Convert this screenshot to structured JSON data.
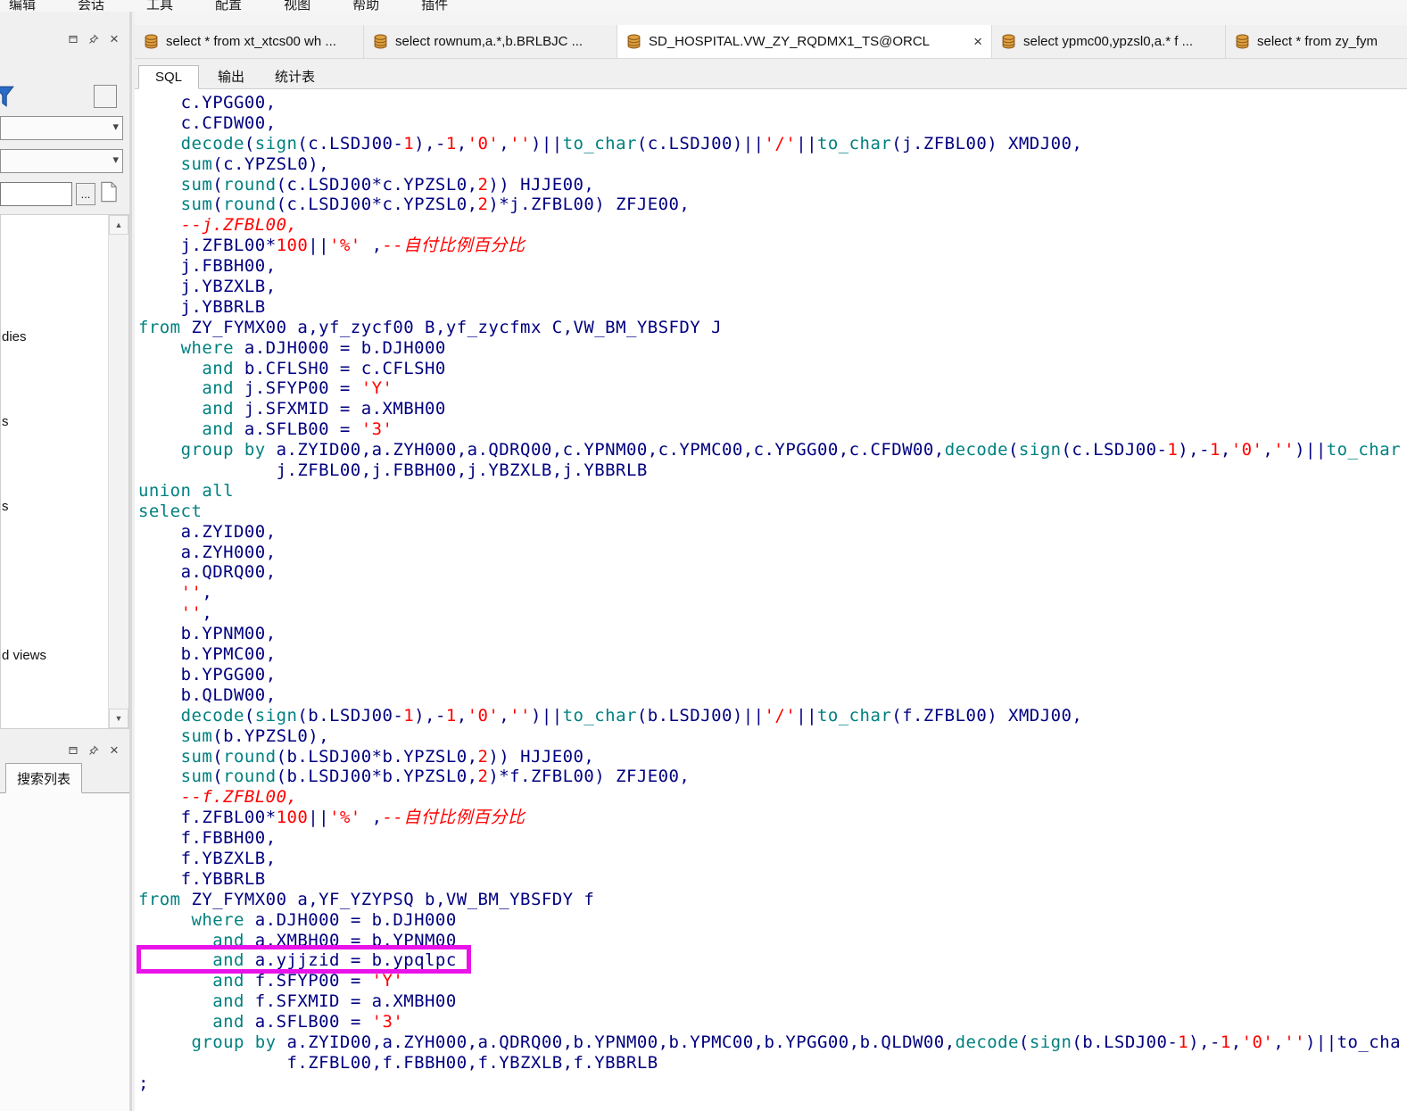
{
  "menu_bar": {
    "items": [
      "编辑",
      "会话",
      "工具",
      "配置",
      "视图",
      "帮助",
      "插件"
    ]
  },
  "document_tabs": [
    {
      "label": "select * from xt_xtcs00 wh ...",
      "active": false
    },
    {
      "label": "select rownum,a.*,b.BRLBJC ...",
      "active": false
    },
    {
      "label": "SD_HOSPITAL.VW_ZY_RQDMX1_TS@ORCL",
      "active": true
    },
    {
      "label": "select ypmc00,ypzsl0,a.* f ...",
      "active": false
    },
    {
      "label": "select * from zy_fym",
      "active": false
    }
  ],
  "view_tabs": [
    {
      "label": "SQL",
      "active": true
    },
    {
      "label": "输出",
      "active": false
    },
    {
      "label": "统计表",
      "active": false
    }
  ],
  "sidebar": {
    "tree_fragments": [
      "dies",
      "s",
      "s",
      "d views"
    ],
    "bottom_tab_label": "搜索列表",
    "ellipsis_label": "..."
  },
  "icons": {
    "close": "×",
    "chevron_down": "▾",
    "scroll_up": "▲",
    "scroll_down": "▼",
    "document_tab_icon": "database-icon"
  },
  "colors": {
    "keyword": "#008080",
    "identifier": "#000080",
    "literal": "#FF0000",
    "highlight_box": "#E912E9",
    "db_icon_fill": "#DFA13D",
    "db_icon_stroke": "#8F5A1E"
  },
  "editor": {
    "keywords": [
      "select",
      "from",
      "where",
      "and",
      "group",
      "by",
      "union",
      "all",
      "decode",
      "sign",
      "sum",
      "round",
      "to_char"
    ],
    "highlight": {
      "line_index": 42
    },
    "sql_lines": [
      "    c.YPGG00,",
      "    c.CFDW00,",
      "    decode(sign(c.LSDJ00-1),-1,'0','')||to_char(c.LSDJ00)||'/'||to_char(j.ZFBL00) XMDJ00,",
      "    sum(c.YPZSL0),",
      "    sum(round(c.LSDJ00*c.YPZSL0,2)) HJJE00,",
      "    sum(round(c.LSDJ00*c.YPZSL0,2)*j.ZFBL00) ZFJE00,",
      "    --j.ZFBL00,",
      "    j.ZFBL00*100||'%' ,--自付比例百分比",
      "    j.FBBH00,",
      "    j.YBZXLB,",
      "    j.YBBRLB",
      "from ZY_FYMX00 a,yf_zycf00 B,yf_zycfmx C,VW_BM_YBSFDY J",
      "    where a.DJH000 = b.DJH000",
      "      and b.CFLSH0 = c.CFLSH0",
      "      and j.SFYP00 = 'Y'",
      "      and j.SFXMID = a.XMBH00",
      "      and a.SFLB00 = '3'",
      "    group by a.ZYID00,a.ZYH000,a.QDRQ00,c.YPNM00,c.YPMC00,c.YPGG00,c.CFDW00,decode(sign(c.LSDJ00-1),-1,'0','')||to_char",
      "             j.ZFBL00,j.FBBH00,j.YBZXLB,j.YBBRLB",
      "union all",
      "select",
      "    a.ZYID00,",
      "    a.ZYH000,",
      "    a.QDRQ00,",
      "    '',",
      "    '',",
      "    b.YPNM00,",
      "    b.YPMC00,",
      "    b.YPGG00,",
      "    b.QLDW00,",
      "    decode(sign(b.LSDJ00-1),-1,'0','')||to_char(b.LSDJ00)||'/'||to_char(f.ZFBL00) XMDJ00,",
      "    sum(b.YPZSL0),",
      "    sum(round(b.LSDJ00*b.YPZSL0,2)) HJJE00,",
      "    sum(round(b.LSDJ00*b.YPZSL0,2)*f.ZFBL00) ZFJE00,",
      "    --f.ZFBL00,",
      "    f.ZFBL00*100||'%' ,--自付比例百分比",
      "    f.FBBH00,",
      "    f.YBZXLB,",
      "    f.YBBRLB",
      "from ZY_FYMX00 a,YF_YZYPSQ b,VW_BM_YBSFDY f",
      "     where a.DJH000 = b.DJH000",
      "       and a.XMBH00 = b.YPNM00",
      "       and a.yjjzid = b.ypqlpc",
      "       and f.SFYP00 = 'Y'",
      "       and f.SFXMID = a.XMBH00",
      "       and a.SFLB00 = '3'",
      "     group by a.ZYID00,a.ZYH000,a.QDRQ00,b.YPNM00,b.YPMC00,b.YPGG00,b.QLDW00,decode(sign(b.LSDJ00-1),-1,'0','')||to_cha",
      "              f.ZFBL00,f.FBBH00,f.YBZXLB,f.YBBRLB",
      ";"
    ]
  }
}
